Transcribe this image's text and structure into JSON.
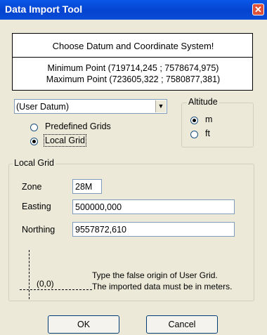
{
  "window": {
    "title": "Data Import Tool",
    "close_icon": "close-icon",
    "accent_color": "#0a58e8"
  },
  "header": {
    "instruction": "Choose Datum and Coordinate System!",
    "min_point": "Minimum Point (719714,245 ; 7578674,975)",
    "max_point": "Maximum Point (723605,322 ; 7580877,381)"
  },
  "datum": {
    "selected": "(User Datum)",
    "dropdown_icon": "chevron-down-icon",
    "grid_options": [
      {
        "label": "Predefined Grids",
        "selected": false
      },
      {
        "label": "Local Grid",
        "selected": true
      }
    ]
  },
  "altitude": {
    "label": "Altitude",
    "options": [
      {
        "label": "m",
        "selected": true
      },
      {
        "label": "ft",
        "selected": false
      }
    ]
  },
  "local_grid": {
    "label": "Local Grid",
    "zone_label": "Zone",
    "zone_value": "28M",
    "easting_label": "Easting",
    "easting_value": "500000,000",
    "northing_label": "Northing",
    "northing_value": "9557872,610",
    "origin_label": "(0,0)",
    "hint_line1": "Type the false origin of User Grid.",
    "hint_line2": "The imported data must be in meters."
  },
  "buttons": {
    "ok": "OK",
    "cancel": "Cancel"
  }
}
